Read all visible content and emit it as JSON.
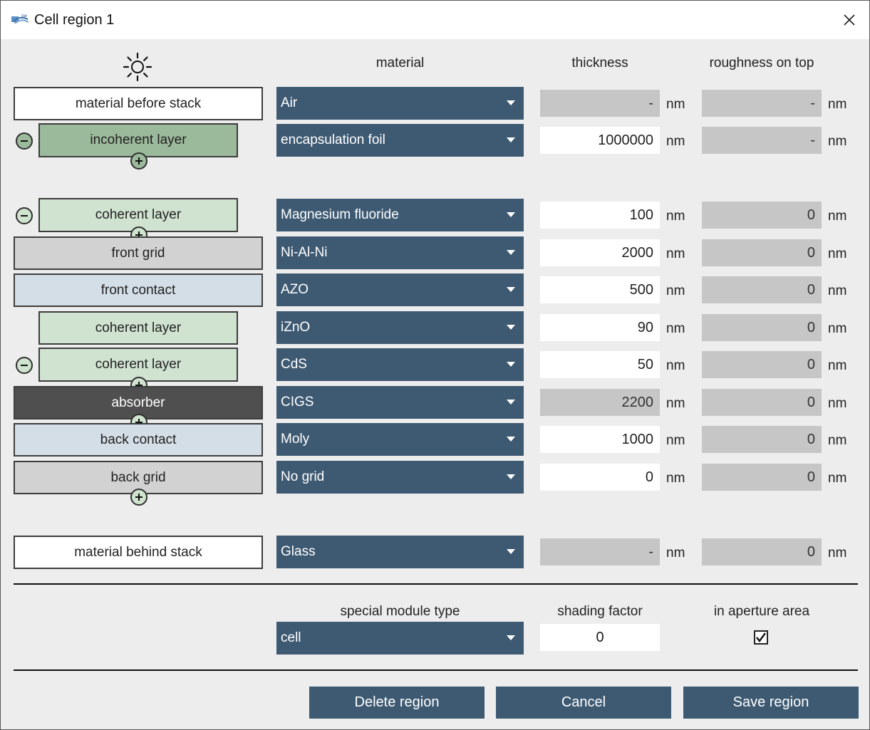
{
  "window": {
    "title": "Cell region 1"
  },
  "headers": {
    "material": "material",
    "thickness": "thickness",
    "roughness": "roughness on top"
  },
  "unit": "nm",
  "rows": [
    {
      "layer": "material before stack",
      "material": "Air",
      "thickness": "-",
      "roughness": "-"
    },
    {
      "layer": "incoherent layer",
      "material": "encapsulation foil",
      "thickness": "1000000",
      "roughness": "-"
    },
    {
      "layer": "coherent layer",
      "material": "Magnesium fluoride",
      "thickness": "100",
      "roughness": "0"
    },
    {
      "layer": "front grid",
      "material": "Ni-Al-Ni",
      "thickness": "2000",
      "roughness": "0"
    },
    {
      "layer": "front contact",
      "material": "AZO",
      "thickness": "500",
      "roughness": "0"
    },
    {
      "layer": "coherent layer",
      "material": "iZnO",
      "thickness": "90",
      "roughness": "0"
    },
    {
      "layer": "coherent layer",
      "material": "CdS",
      "thickness": "50",
      "roughness": "0"
    },
    {
      "layer": "absorber",
      "material": "CIGS",
      "thickness": "2200",
      "roughness": "0"
    },
    {
      "layer": "back contact",
      "material": "Moly",
      "thickness": "1000",
      "roughness": "0"
    },
    {
      "layer": "back grid",
      "material": "No grid",
      "thickness": "0",
      "roughness": "0"
    },
    {
      "layer": "material behind stack",
      "material": "Glass",
      "thickness": "-",
      "roughness": "0"
    }
  ],
  "bottom": {
    "module_type_label": "special module type",
    "module_type": "cell",
    "shading_label": "shading factor",
    "shading_value": "0",
    "aperture_label": "in aperture area",
    "aperture_checked": true
  },
  "buttons": {
    "delete": "Delete region",
    "cancel": "Cancel",
    "save": "Save region"
  },
  "colors": {
    "accent": "#3e5a73",
    "incoherent": "#9bb99b",
    "coherent": "#d0e2d0",
    "grid": "#d2d2d2",
    "contact": "#d3dee6",
    "absorber": "#4f4f4f"
  }
}
